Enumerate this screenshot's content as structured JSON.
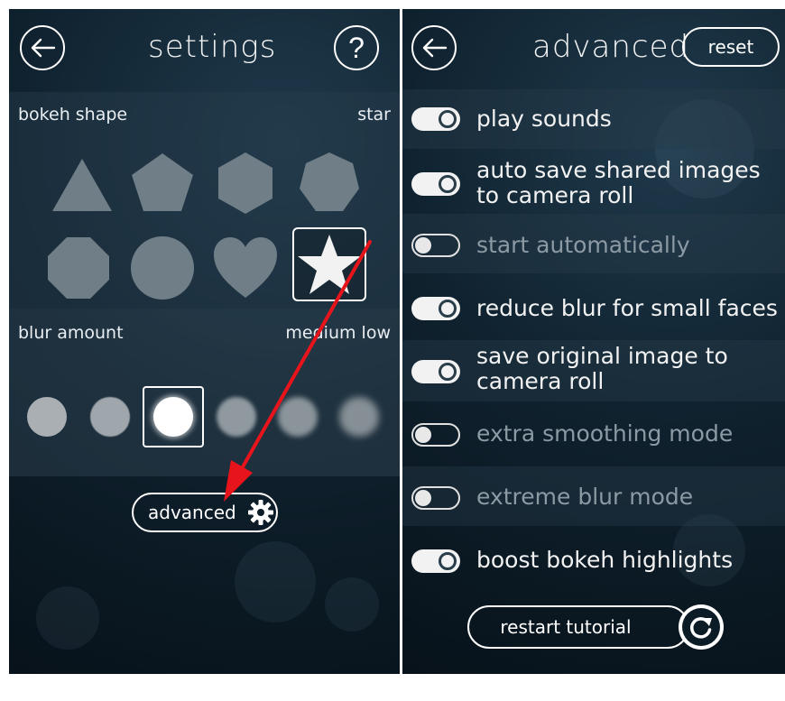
{
  "settings": {
    "title": "settings",
    "back_icon": "arrow-left-icon",
    "help_label": "?",
    "bokeh_shape": {
      "label": "bokeh shape",
      "value": "star",
      "shapes": [
        "triangle",
        "pentagon",
        "hexagon",
        "heptagon",
        "octagon",
        "circle",
        "heart",
        "star"
      ],
      "selected": "star"
    },
    "blur_amount": {
      "label": "blur amount",
      "value": "medium low",
      "levels": 6,
      "selected_index": 2
    },
    "advanced_button_label": "advanced",
    "advanced_icon": "gear-icon"
  },
  "advanced": {
    "title": "advanced",
    "back_icon": "arrow-left-icon",
    "reset_label": "reset",
    "options": [
      {
        "label": "play sounds",
        "on": true
      },
      {
        "label": "auto save shared images to camera roll",
        "on": true
      },
      {
        "label": "start automatically",
        "on": false
      },
      {
        "label": "reduce blur for small faces",
        "on": true
      },
      {
        "label": "save original image to camera roll",
        "on": true
      },
      {
        "label": "extra smoothing mode",
        "on": false
      },
      {
        "label": "extreme blur mode",
        "on": false
      },
      {
        "label": "boost bokeh highlights",
        "on": true
      }
    ],
    "restart_label": "restart tutorial",
    "restart_icon": "refresh-icon"
  },
  "colors": {
    "annotation_arrow": "#e8141b",
    "background": "#0c1c27",
    "toggle_on": "#f2f2f2",
    "disabled_text": "#8c9aa4"
  }
}
